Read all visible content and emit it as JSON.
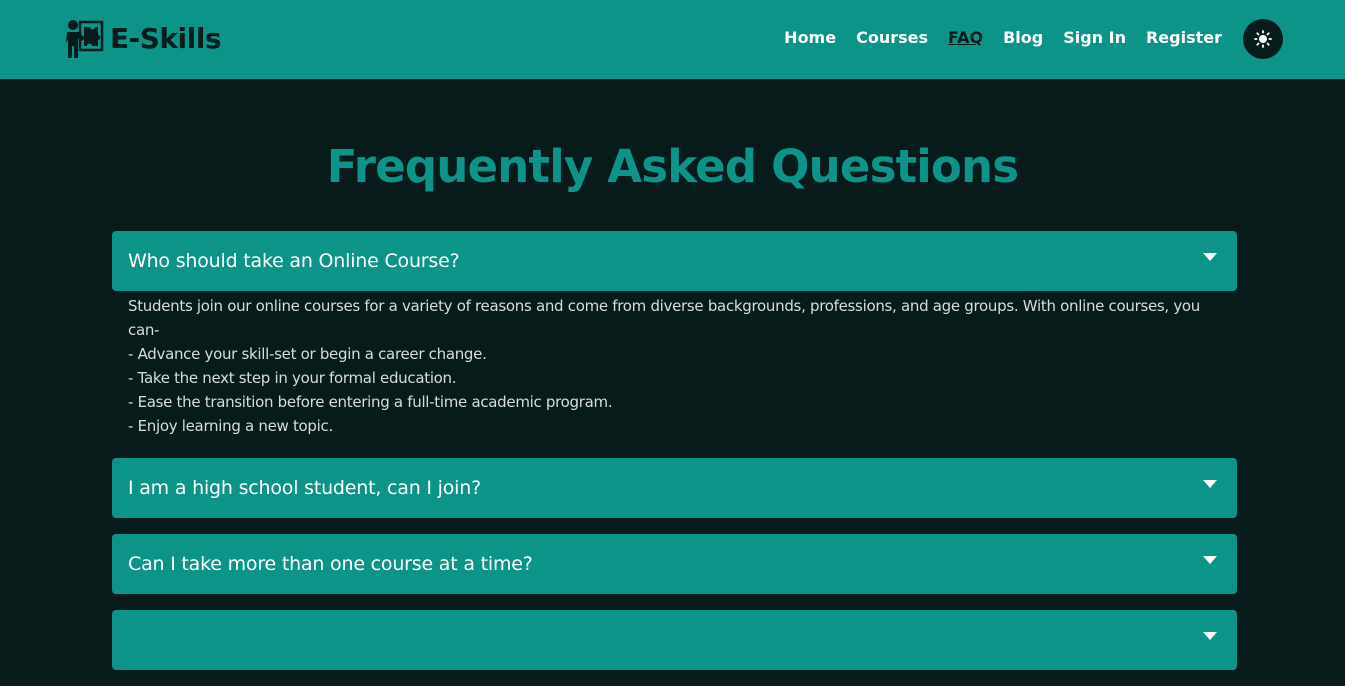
{
  "brand": {
    "name": "E-Skills",
    "logo_icon": "teacher-puzzle-icon"
  },
  "nav": {
    "items": [
      {
        "label": "Home",
        "active": false
      },
      {
        "label": "Courses",
        "active": false
      },
      {
        "label": "FAQ",
        "active": true
      },
      {
        "label": "Blog",
        "active": false
      },
      {
        "label": "Sign In",
        "active": false
      },
      {
        "label": "Register",
        "active": false
      }
    ],
    "theme_toggle_icon": "sun-icon"
  },
  "page": {
    "title": "Frequently Asked Questions"
  },
  "faq": {
    "items": [
      {
        "question": "Who should take an Online Course?",
        "expanded": true,
        "answer": {
          "intro": "Students join our online courses for a variety of reasons and come from diverse backgrounds, professions, and age groups. With online courses, you can-",
          "points": [
            "- Advance your skill-set or begin a career change.",
            "- Take the next step in your formal education.",
            "- Ease the transition before entering a full-time academic program.",
            "- Enjoy learning a new topic."
          ]
        }
      },
      {
        "question": "I am a high school student, can I join?",
        "expanded": false
      },
      {
        "question": "Can I take more than one course at a time?",
        "expanded": false
      },
      {
        "question": "",
        "expanded": false
      }
    ],
    "expand_icon": "caret-down-icon"
  },
  "colors": {
    "primary": "#0d9488",
    "background": "#071b1b",
    "text_light": "#ffffff",
    "text_muted": "#d8dcdc"
  }
}
